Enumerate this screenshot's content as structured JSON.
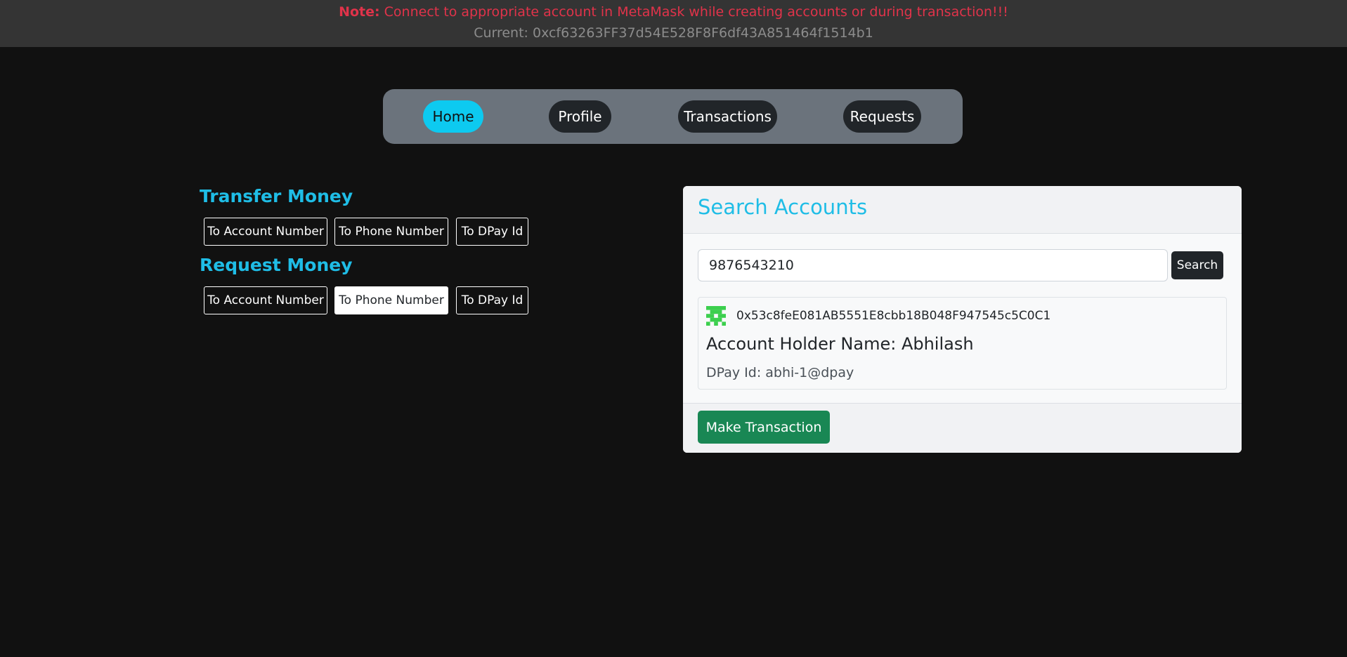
{
  "notice": {
    "label": "Note:",
    "message": "Connect to appropriate account in MetaMask while creating accounts or during transaction!!!",
    "current": "Current: 0xcf63263FF37d54E528F8F6df43A851464f1514b1"
  },
  "nav": {
    "items": [
      {
        "label": "Home",
        "active": true
      },
      {
        "label": "Profile",
        "active": false
      },
      {
        "label": "Transactions",
        "active": false
      },
      {
        "label": "Requests",
        "active": false
      }
    ]
  },
  "transfer": {
    "heading": "Transfer Money",
    "options": [
      "To Account Number",
      "To Phone Number",
      "To DPay Id"
    ]
  },
  "request": {
    "heading": "Request Money",
    "options": [
      "To Account Number",
      "To Phone Number",
      "To DPay Id"
    ],
    "selected": "To Phone Number"
  },
  "search": {
    "title": "Search Accounts",
    "input_value": "9876543210",
    "button_label": "Search"
  },
  "result": {
    "icon": "identicon-icon",
    "address": "0x53c8feE081AB5551E8cbb18B048F947545c5C0C1",
    "holder_name": "Account Holder Name: Abhilash",
    "dpay_id": "DPay Id: abhi-1@dpay"
  },
  "footer": {
    "button_label": "Make Transaction"
  },
  "colors": {
    "accent": "#0dcaf0",
    "heading": "#1fbde6",
    "note": "#e0334a",
    "success": "#198754",
    "background": "#111111"
  }
}
